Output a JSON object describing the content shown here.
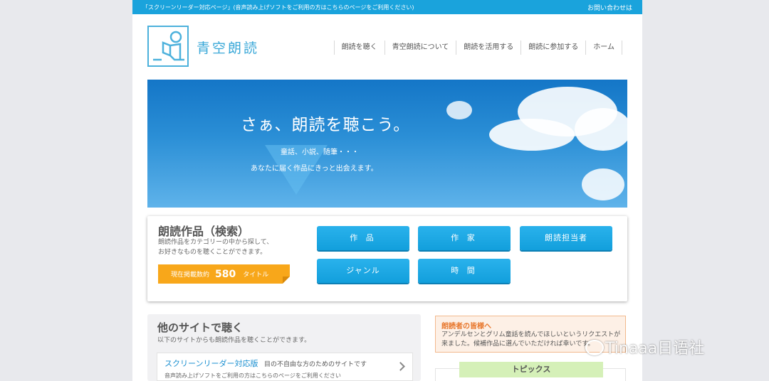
{
  "topbar": {
    "screen_reader_text": "「スクリーンリーダー対応ページ」(音声読み上げソフトをご利用の方はこちらのページをご利用ください)",
    "contact": "お問い合わせは"
  },
  "header": {
    "logo_text": "青空朗読",
    "nav": [
      {
        "label": "朗読を聴く"
      },
      {
        "label": "青空朗読について"
      },
      {
        "label": "朗読を活用する"
      },
      {
        "label": "朗読に参加する"
      },
      {
        "label": "ホーム"
      }
    ]
  },
  "hero": {
    "title": "さぁ、朗読を聴こう。",
    "subtitle_1": "童話、小説、随筆・・・",
    "subtitle_2": "あなたに届く作品にきっと出会えます。"
  },
  "search": {
    "title": "朗読作品（検索）",
    "desc_1": "朗読作品をカテゴリーの中から探して、",
    "desc_2": "お好きなものを聴くことができます。",
    "count_prefix": "現在掲載数約",
    "count": "580",
    "count_suffix": "タイトル",
    "categories": [
      {
        "label": "作 品"
      },
      {
        "label": "作 家"
      },
      {
        "label": "朗読担当者"
      },
      {
        "label": "ジャンル"
      },
      {
        "label": "時 間"
      }
    ]
  },
  "others": {
    "title": "他のサイトで聴く",
    "desc": "以下のサイトからも朗読作品を聴くことができます。",
    "card": {
      "title": "スクリーンリーダー対応版",
      "subtitle": "目の不自由な方のためのサイトです",
      "desc": "音声読み上げソフトをご利用の方はこちらのページをご利用ください"
    }
  },
  "notice": {
    "title": "朗読者の皆様へ",
    "body": "アンデルセンとグリム童話を読んでほしいというリクエストが来ました。候補作品に選んでいただければ幸いです。"
  },
  "topics": {
    "label": "トピックス"
  },
  "watermark": {
    "text": "Tinaaa日语社"
  }
}
